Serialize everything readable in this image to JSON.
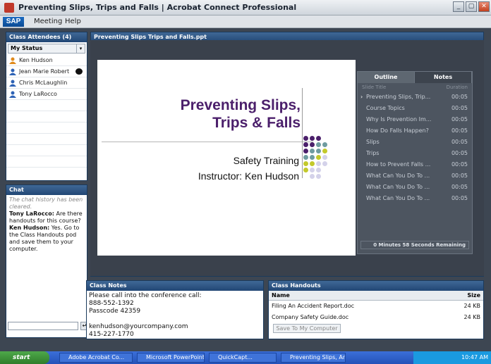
{
  "window": {
    "title": "Preventing Slips, Trips and Falls | Acrobat Connect Professional"
  },
  "menubar": {
    "logo": "SAP",
    "items": [
      "Meeting",
      "Help"
    ]
  },
  "attendees": {
    "header": "Class Attendees (4)",
    "status_label": "My Status",
    "people": [
      {
        "name": "Ken Hudson",
        "role": "host"
      },
      {
        "name": "Jean Marie Robert",
        "role": "participant"
      },
      {
        "name": "Chris McLaughlin",
        "role": "participant"
      },
      {
        "name": "Tony LaRocco",
        "role": "participant"
      }
    ]
  },
  "chat": {
    "header": "Chat",
    "system_message": "The chat history has been cleared.",
    "messages": [
      {
        "sender": "Tony LaRocco:",
        "text": " Are there handouts for this course?"
      },
      {
        "sender": "Ken Hudson:",
        "text": " Yes.  Go to the Class Handouts pod and save them to your computer."
      }
    ]
  },
  "share": {
    "header": "Preventing Slips Trips and Falls.ppt",
    "slide": {
      "title": "Preventing Slips,\nTrips & Falls",
      "subtitle1": "Safety Training",
      "subtitle2": "Instructor: Ken Hudson"
    },
    "tabs": [
      "Outline",
      "Notes"
    ],
    "outline_cols": [
      "Slide Title",
      "Duration"
    ],
    "outline": [
      {
        "title": "Preventing Slips, Trip...",
        "dur": "00:05"
      },
      {
        "title": "Course Topics",
        "dur": "00:05"
      },
      {
        "title": "Why Is Prevention Im...",
        "dur": "00:05"
      },
      {
        "title": "How Do Falls Happen?",
        "dur": "00:05"
      },
      {
        "title": "Slips",
        "dur": "00:05"
      },
      {
        "title": "Trips",
        "dur": "00:05"
      },
      {
        "title": "How to Prevent Falls ...",
        "dur": "00:05"
      },
      {
        "title": "What Can You Do To ...",
        "dur": "00:05"
      },
      {
        "title": "What Can You Do To ...",
        "dur": "00:05"
      },
      {
        "title": "What Can You Do To ...",
        "dur": "00:05"
      }
    ],
    "remaining": "0 Minutes 58 Seconds Remaining"
  },
  "notes": {
    "header": "Class Notes",
    "body": "Please call into the conference call:\n888-552-1392\nPasscode 42359\n\nkenhudson@yourcompany.com\n415-227-1770"
  },
  "handouts": {
    "header": "Class Handouts",
    "cols": [
      "Name",
      "Size"
    ],
    "files": [
      {
        "name": "Filing An Accident Report.doc",
        "size": "24 KB"
      },
      {
        "name": "Company Safety Guide.doc",
        "size": "24 KB"
      }
    ],
    "save_label": "Save To My Computer"
  },
  "taskbar": {
    "start": "start",
    "items": [
      "Adobe Acrobat Co...",
      "Microsoft PowerPoint...",
      "QuickCapt...",
      "Preventing Slips, Ani..."
    ],
    "clock": "10:47 AM"
  },
  "colors": {
    "accent_purple": "#4b1f6b",
    "dot_teal": "#6f9ca0",
    "dot_lime": "#c3c92b",
    "dot_lavender": "#d4d2ea"
  }
}
